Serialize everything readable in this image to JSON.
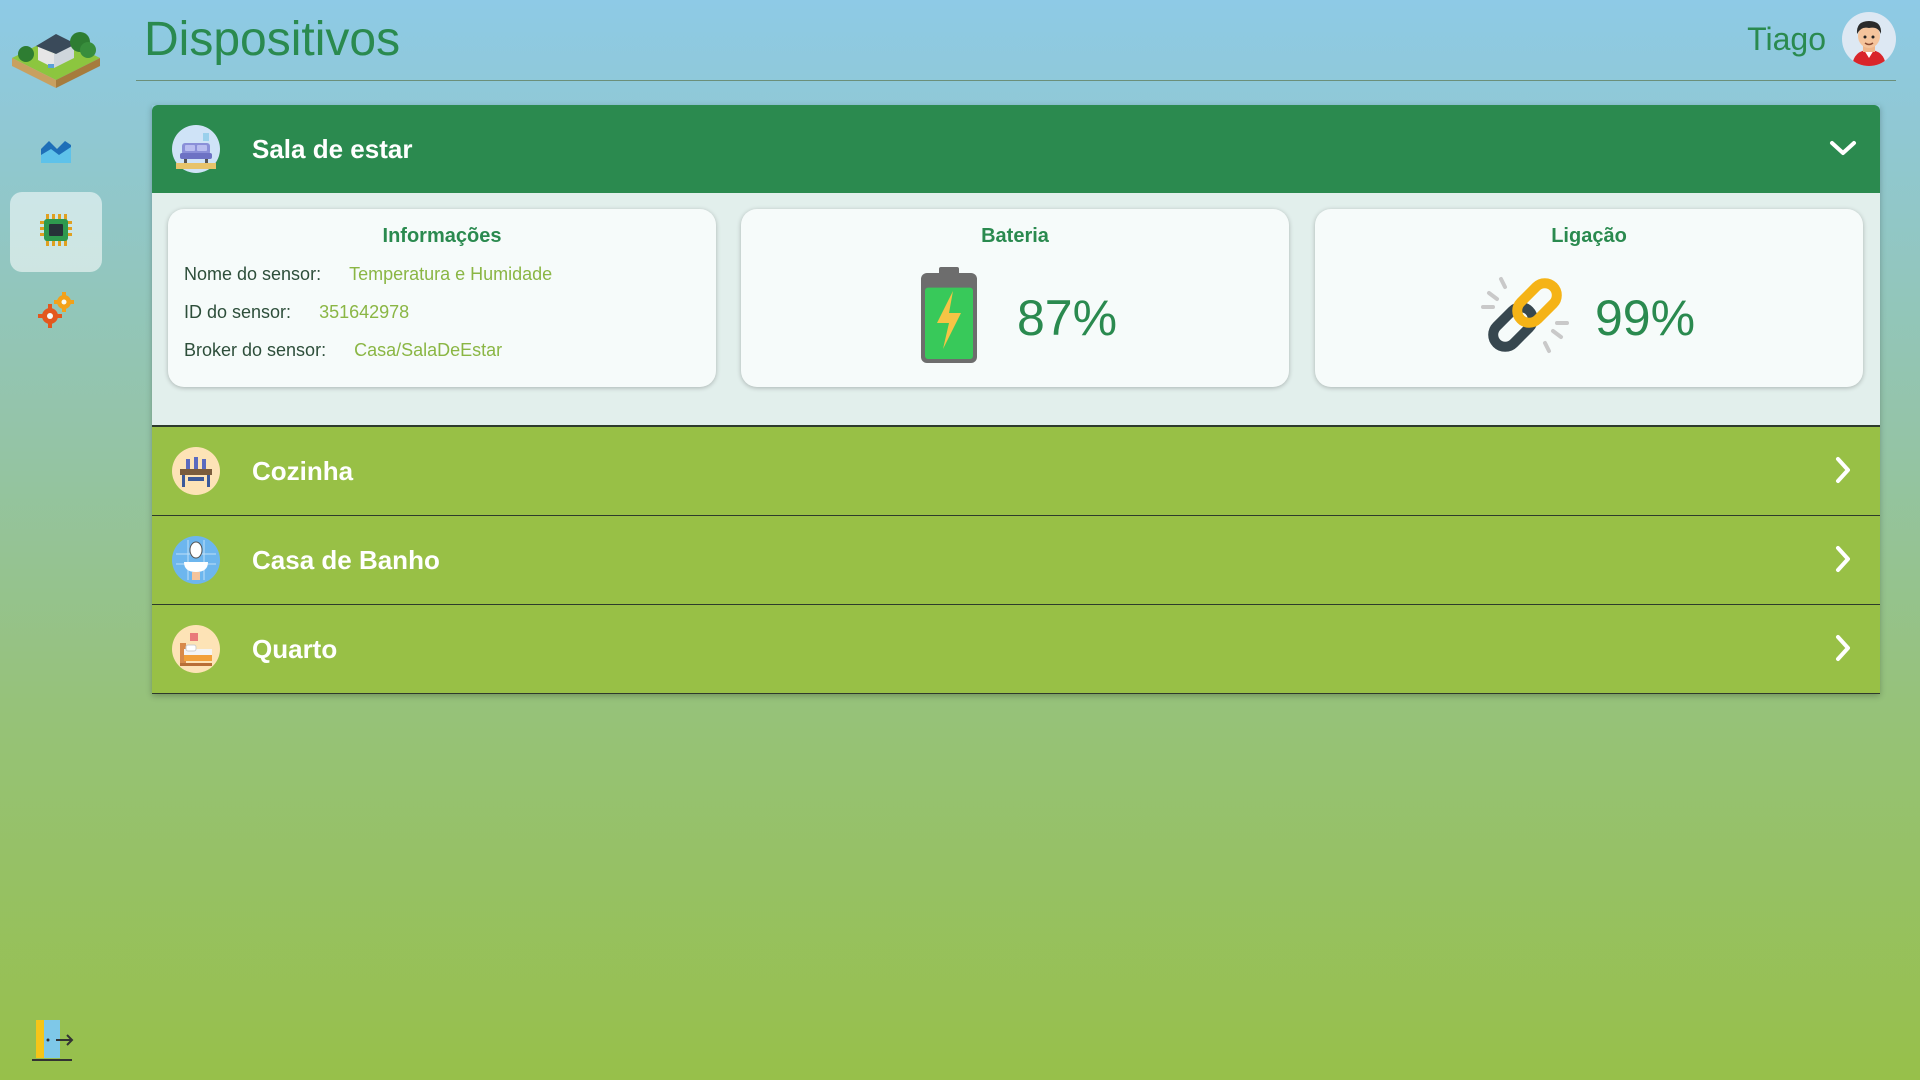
{
  "header": {
    "title": "Dispositivos",
    "user_name": "Tiago"
  },
  "sidebar": {
    "items": [
      {
        "name": "charts",
        "icon": "area-chart-icon"
      },
      {
        "name": "devices",
        "icon": "chip-icon",
        "active": true
      },
      {
        "name": "settings",
        "icon": "gears-icon"
      }
    ],
    "logout_icon": "logout-door-icon"
  },
  "rooms": [
    {
      "label": "Sala de estar",
      "expanded": true,
      "icon": "living-room-icon"
    },
    {
      "label": "Cozinha",
      "expanded": false,
      "icon": "kitchen-icon"
    },
    {
      "label": "Casa de Banho",
      "expanded": false,
      "icon": "bathroom-icon"
    },
    {
      "label": "Quarto",
      "expanded": false,
      "icon": "bedroom-icon"
    }
  ],
  "info_card": {
    "title": "Informações",
    "sensor_name_label": "Nome do sensor:",
    "sensor_name": "Temperatura e Humidade",
    "sensor_id_label": "ID do sensor:",
    "sensor_id": "351642978",
    "broker_label": "Broker do sensor:",
    "broker": "Casa/SalaDeEstar"
  },
  "battery_card": {
    "title": "Bateria",
    "value": "87%",
    "level": 0.87
  },
  "link_card": {
    "title": "Ligação",
    "value": "99%"
  },
  "colors": {
    "primary_green": "#2b8a4f",
    "light_green": "#98c046",
    "panel_bg": "#e2efec"
  }
}
